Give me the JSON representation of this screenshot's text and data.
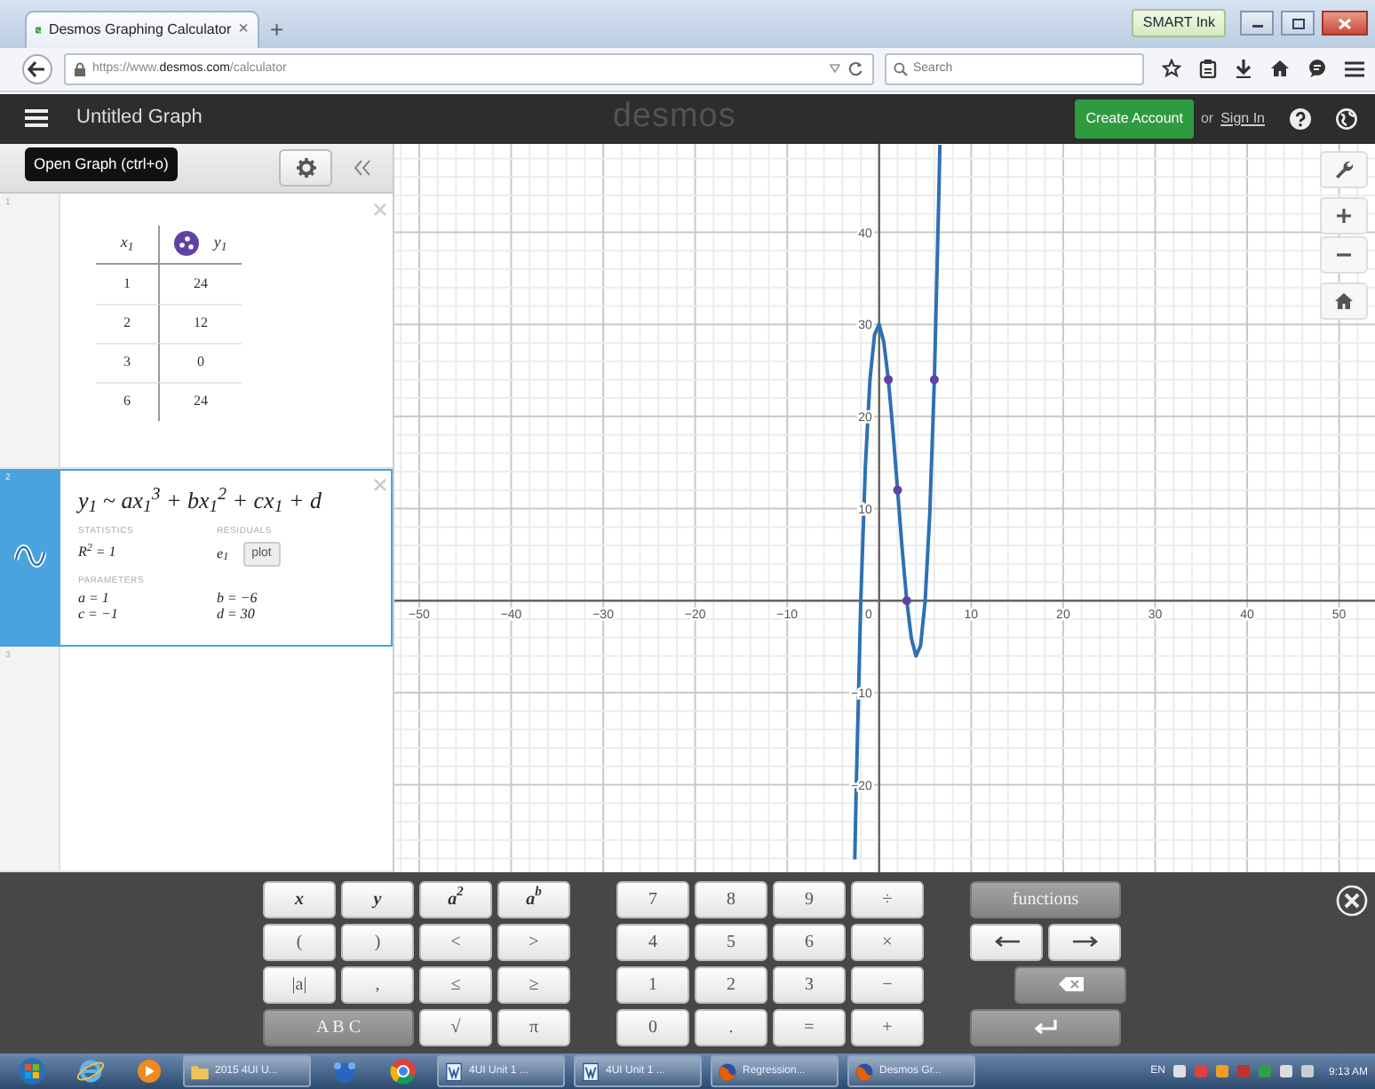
{
  "browser": {
    "tab_title": "Desmos Graphing Calculator",
    "tab_close": "×",
    "new_tab": "+",
    "smart_ink": "SMART Ink",
    "url": "https://www.**desmos.com**/calculator",
    "search_placeholder": "Search"
  },
  "header": {
    "graph_title": "Untitled Graph",
    "logo": "desmos",
    "create_account": "Create Account",
    "or": "or",
    "sign_in": "Sign In"
  },
  "tooltip": "Open Graph (ctrl+o)",
  "expressions": [
    {
      "kind": "table",
      "index": "1",
      "selected": false,
      "color": "#6042a6",
      "columns": [
        "x$_{1}$",
        "y$_{1}$"
      ],
      "rows": [
        [
          "1",
          "24"
        ],
        [
          "2",
          "12"
        ],
        [
          "3",
          "0"
        ],
        [
          "6",
          "24"
        ]
      ]
    },
    {
      "kind": "regression",
      "index": "2",
      "selected": true,
      "color": "#2d70b3",
      "formula": "y$_{1}$ ~ ax$_{1}$$^{3}$ + bx$_{1}$$^{2}$ + cx$_{1}$ + d",
      "statistics_label": "STATISTICS",
      "r2": "R$^{2}$ = 1",
      "residuals_label": "RESIDUALS",
      "residual": "e$_{1}$",
      "plot": "plot",
      "parameters_label": "PARAMETERS",
      "parameters": [
        "a = 1",
        "b = −6",
        "c = −1",
        "d = 30"
      ]
    },
    {
      "kind": "empty",
      "index": "3",
      "selected": false
    }
  ],
  "graph": {
    "origin_label": "0",
    "chart_data": {
      "type": "line",
      "x": [
        -2.65,
        -2.5,
        -2,
        -1.5,
        -1,
        -0.5,
        0,
        0.5,
        1,
        1.5,
        2,
        2.5,
        3,
        3.5,
        4,
        4.5,
        5,
        5.5,
        6,
        6.5,
        6.6
      ],
      "series": [
        {
          "color": "#2d70b3",
          "values": [
            -28.1,
            -20.6,
            0,
            14.6,
            24,
            28.9,
            30,
            28.1,
            24,
            18.4,
            12,
            5.6,
            0,
            -4.1,
            -6,
            -4.9,
            0,
            9.4,
            24,
            44.6,
            49.5
          ]
        }
      ],
      "xlim": [
        -52.7,
        53.9
      ],
      "ylim": [
        -29.5,
        49.6
      ],
      "xticks": [
        -50,
        -40,
        -30,
        -20,
        -10,
        10,
        20,
        30,
        40,
        50
      ],
      "yticks": [
        -20,
        -10,
        10,
        20,
        30,
        40
      ],
      "grid": true
    }
  },
  "keyboard": {
    "blocks": [
      {
        "keys": [
          {
            "label": "x",
            "kind": "var"
          },
          {
            "label": "y",
            "kind": "var"
          },
          {
            "label": "a$^{2}$",
            "kind": "var"
          },
          {
            "label": "a$^{b}$",
            "kind": "var"
          },
          {
            "label": "(",
            "kind": "op"
          },
          {
            "label": ")",
            "kind": "op"
          },
          {
            "label": "<",
            "kind": "op"
          },
          {
            "label": ">",
            "kind": "op"
          },
          {
            "label": "|a|",
            "kind": "op"
          },
          {
            "label": ",",
            "kind": "op"
          },
          {
            "label": "≤",
            "kind": "op"
          },
          {
            "label": "≥",
            "kind": "op"
          },
          {
            "label": "A B C",
            "kind": "dark"
          },
          {
            "label": "√",
            "kind": "op"
          },
          {
            "label": "π",
            "kind": "op"
          }
        ]
      },
      {
        "keys": [
          {
            "label": "7",
            "kind": "op"
          },
          {
            "label": "8",
            "kind": "op"
          },
          {
            "label": "9",
            "kind": "op"
          },
          {
            "label": "÷",
            "kind": "op"
          },
          {
            "label": "4",
            "kind": "op"
          },
          {
            "label": "5",
            "kind": "op"
          },
          {
            "label": "6",
            "kind": "op"
          },
          {
            "label": "×",
            "kind": "op"
          },
          {
            "label": "1",
            "kind": "op"
          },
          {
            "label": "2",
            "kind": "op"
          },
          {
            "label": "3",
            "kind": "op"
          },
          {
            "label": "−",
            "kind": "op"
          },
          {
            "label": "0",
            "kind": "op"
          },
          {
            "label": ".",
            "kind": "op"
          },
          {
            "label": "=",
            "kind": "op"
          },
          {
            "label": "+",
            "kind": "op"
          }
        ]
      },
      {
        "keys": [
          {
            "label": "functions",
            "kind": "dark"
          },
          {
            "kind": "left"
          },
          {
            "kind": "right"
          },
          {
            "kind": "backspace"
          },
          {
            "kind": "enter"
          }
        ]
      }
    ]
  },
  "taskbar": {
    "items": [
      {
        "kind": "orb"
      },
      {
        "kind": "ie"
      },
      {
        "kind": "media"
      },
      {
        "kind": "folder",
        "label": "2015 4UI U..."
      },
      {
        "kind": "network"
      },
      {
        "kind": "chrome"
      },
      {
        "kind": "doc",
        "label": "4UI Unit 1 ..."
      },
      {
        "kind": "doc",
        "label": "4UI Unit 1 ..."
      },
      {
        "kind": "firefox",
        "label": "Regression..."
      },
      {
        "kind": "firefox",
        "label": "Desmos Gr..."
      }
    ],
    "language": "EN",
    "time": "9:13 AM"
  }
}
